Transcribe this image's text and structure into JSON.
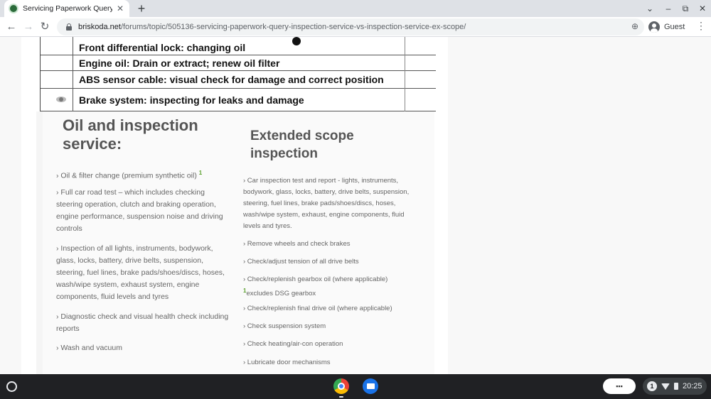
{
  "browser": {
    "tab_title": "Servicing Paperwork Query Inspec",
    "tab_close": "✕",
    "new_tab": "+",
    "win_dropdown": "⌄",
    "win_minimize": "–",
    "win_restore": "⧉",
    "win_close": "✕",
    "url_host": "briskoda.net",
    "url_path": "/forums/topic/505136-servicing-paperwork-query-inspection-service-vs-inspection-service-ex-scope/",
    "profile_label": "Guest"
  },
  "scan_table": {
    "rows": [
      "Front differential lock: changing oil",
      "Engine oil: Drain or extract; renew oil filter",
      "ABS sensor cable: visual check for damage and correct position",
      "Brake system: inspecting for leaks and damage"
    ]
  },
  "brochure": {
    "left_heading": "Oil and inspection service:",
    "right_heading": "Extended scope inspection",
    "left_items": [
      "› Oil & filter change (premium synthetic oil)",
      "› Full car road test – which includes checking steering operation, clutch and braking operation, engine performance, suspension noise and driving controls",
      "› Inspection of all lights, instruments, bodywork, glass, locks, battery, drive belts, suspension, steering, fuel lines, brake pads/shoes/discs, hoses, wash/wipe system, exhaust system, engine components, fluid levels and tyres",
      "› Diagnostic check and visual health check including reports",
      "› Wash and vacuum"
    ],
    "footnote_mark": "1",
    "right_items": [
      "› Car inspection test and report - lights, instruments, bodywork, glass, locks, battery, drive belts, suspension, steering, fuel lines, brake pads/shoes/discs, hoses, wash/wipe system, exhaust, engine components, fluid levels and tyres.",
      "› Remove wheels and check brakes",
      "› Check/adjust tension of all drive belts",
      "› Check/replenish gearbox oil (where applicable)",
      "excludes DSG gearbox",
      "› Check/replenish final drive oil (where applicable)",
      "› Check suspension system",
      "› Check heating/air-con operation",
      "› Lubricate door mechanisms"
    ]
  },
  "shelf": {
    "notification_count": "1",
    "clock": "20:25"
  }
}
